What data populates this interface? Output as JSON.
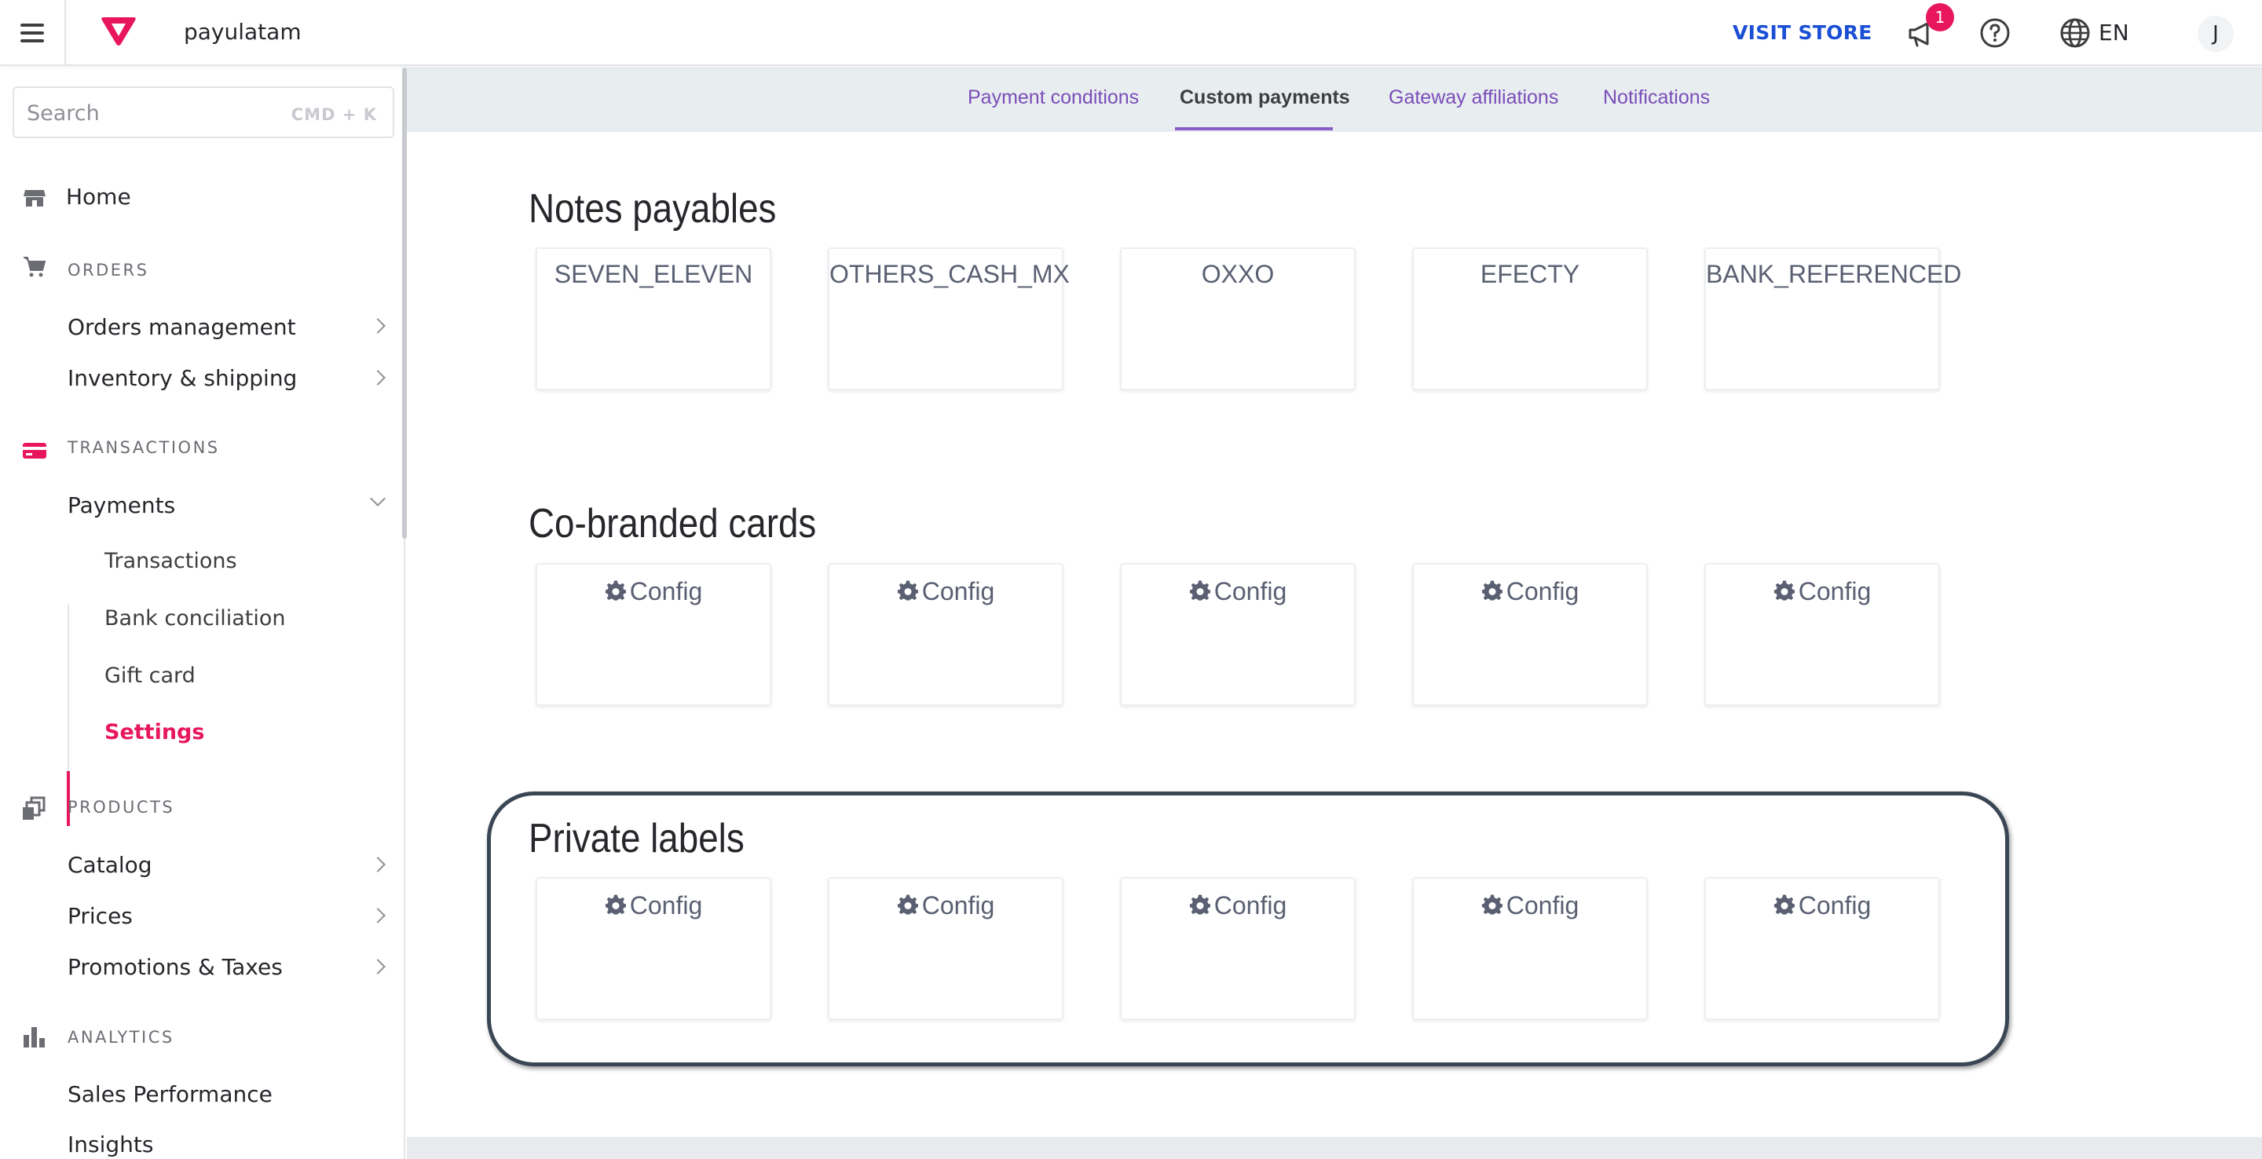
{
  "header": {
    "store_name": "payulatam",
    "visit_store": "VISIT STORE",
    "notification_count": "1",
    "language": "EN",
    "user_initial": "J",
    "brand_color": "#e8175d",
    "link_color": "#1a4fd6"
  },
  "search": {
    "placeholder": "Search",
    "shortcut": "CMD + K"
  },
  "sidebar": {
    "home": "Home",
    "orders": {
      "section": "ORDERS",
      "items": [
        "Orders management",
        "Inventory & shipping"
      ]
    },
    "transactions": {
      "section": "TRANSACTIONS",
      "payments": "Payments",
      "sub_items": [
        "Transactions",
        "Bank conciliation",
        "Gift card",
        "Settings"
      ],
      "active_sub": "Settings"
    },
    "products": {
      "section": "PRODUCTS",
      "items": [
        "Catalog",
        "Prices",
        "Promotions & Taxes"
      ]
    },
    "analytics": {
      "section": "ANALYTICS",
      "items": [
        "Sales Performance",
        "Insights"
      ]
    }
  },
  "tabs": {
    "items": [
      "Payment conditions",
      "Custom payments",
      "Gateway affiliations",
      "Notifications"
    ],
    "active": "Custom payments"
  },
  "sections": {
    "notes_payables": {
      "title": "Notes payables",
      "cards": [
        "SEVEN_ELEVEN",
        "OTHERS_CASH_MX",
        "OXXO",
        "EFECTY",
        "BANK_REFERENCED"
      ]
    },
    "co_branded": {
      "title": "Co-branded cards",
      "cards": [
        "Config",
        "Config",
        "Config",
        "Config",
        "Config"
      ]
    },
    "private_labels": {
      "title": "Private labels",
      "cards": [
        "Config",
        "Config",
        "Config",
        "Config",
        "Config"
      ]
    }
  }
}
